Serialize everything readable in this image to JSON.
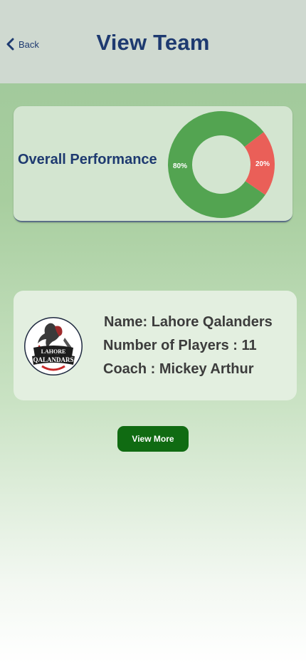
{
  "header": {
    "back_label": "Back",
    "title": "View Team"
  },
  "performance": {
    "label": "Overall Performance",
    "chart_data": {
      "type": "pie",
      "categories": [
        "80%",
        "20%"
      ],
      "values": [
        80,
        20
      ],
      "colors": [
        "#53a451",
        "#ea5f58"
      ]
    }
  },
  "team": {
    "name_text": "Name: Lahore Qalanders",
    "players_text": "Number of Players : 11",
    "coach_text": "Coach : Mickey Arthur",
    "logo_text": [
      "LAHORE",
      "QALANDARS"
    ]
  },
  "actions": {
    "view_more_label": "View More"
  },
  "colors": {
    "header_bg": "#cfd9d0",
    "title": "#1e3a70",
    "button": "#106b12"
  },
  "icons": {
    "back": "chevron-left-icon"
  }
}
